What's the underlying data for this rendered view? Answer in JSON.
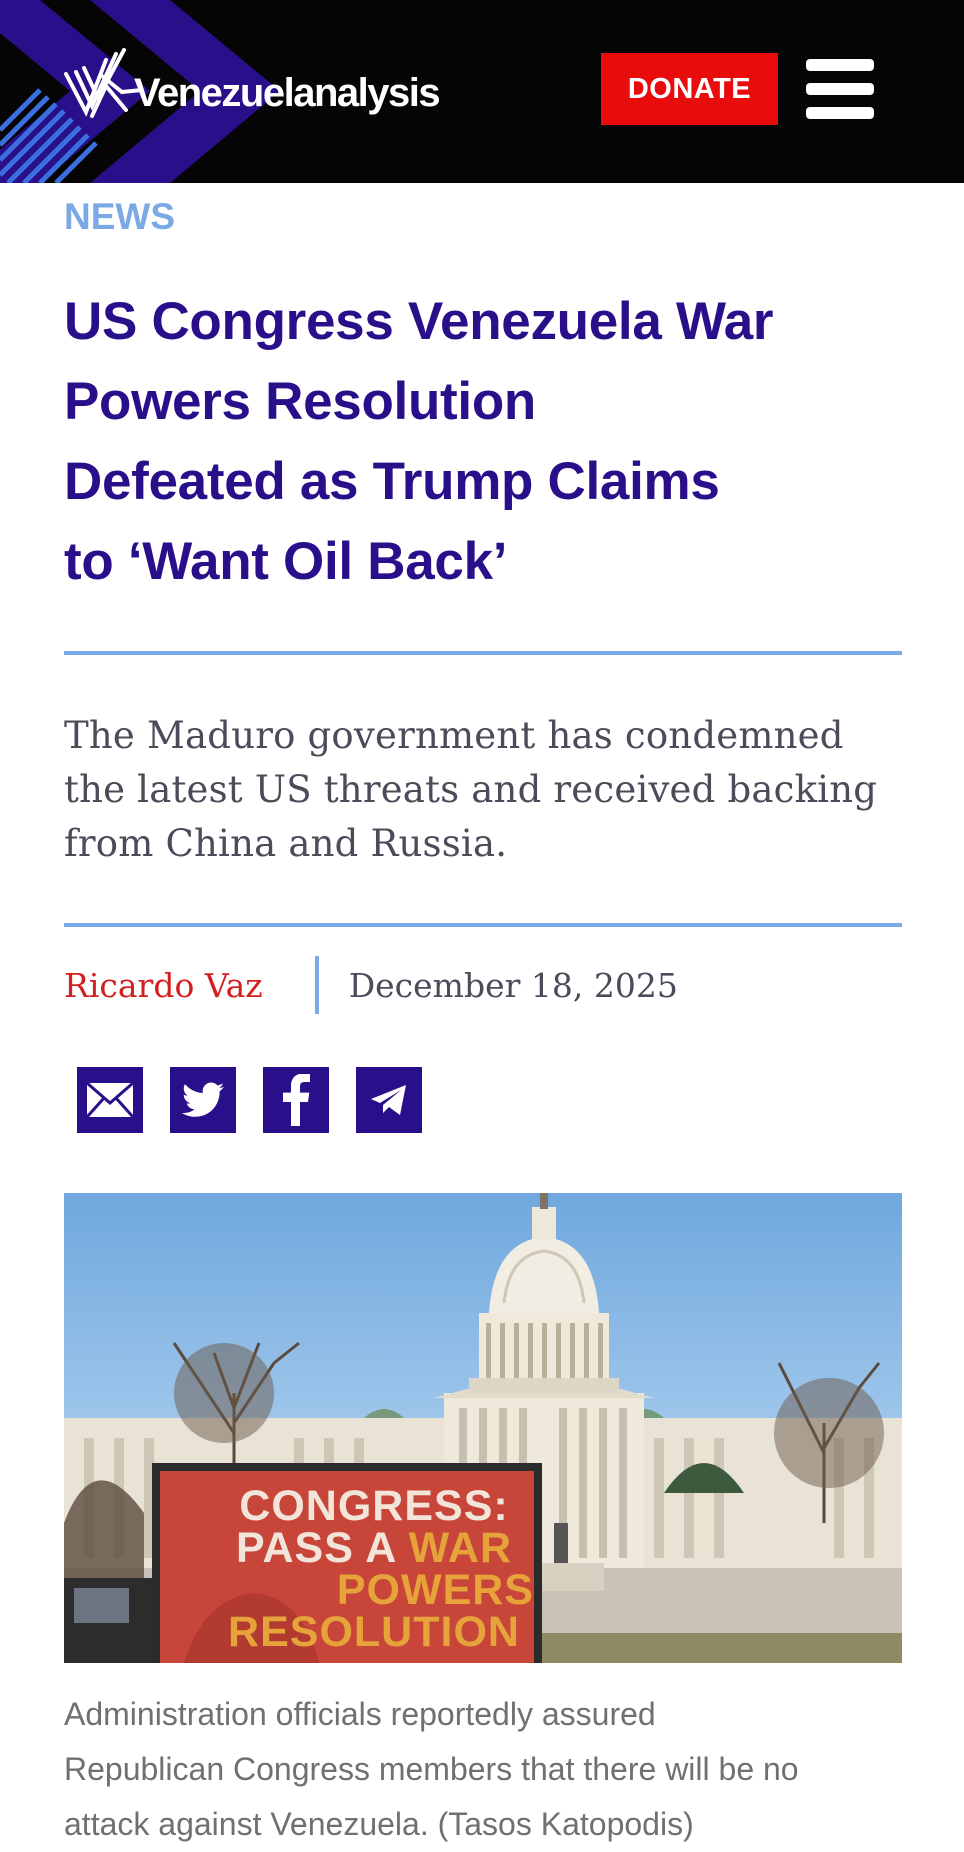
{
  "header": {
    "brand": "Venezuelanalysis",
    "donate_label": "DONATE",
    "colors": {
      "background": "#050505",
      "chevrons": "#2a0f8a",
      "donate": "#e90c0c"
    }
  },
  "article": {
    "category": "NEWS",
    "headline_lines": [
      "US Congress Venezuela War",
      "Powers Resolution",
      "Defeated as Trump Claims",
      "to ‘Want Oil Back’"
    ],
    "dek_lines": [
      "The Maduro government has condemned",
      "the latest US threats and received backing",
      "from China and Russia."
    ],
    "author": "Ricardo Vaz",
    "date": "December 18, 2025",
    "share_icons": [
      "email-icon",
      "twitter-icon",
      "facebook-icon",
      "telegram-icon"
    ],
    "colors": {
      "headline": "#2a0f8a",
      "accent": "#7aa9e6",
      "author": "#d31f1f"
    }
  },
  "photo": {
    "sign": {
      "line1": "CONGRESS:",
      "line2_a": "PASS A ",
      "line2_b": "WAR",
      "line3": "POWERS",
      "line4": "RESOLUTION"
    }
  },
  "caption_lines": [
    "Administration officials reportedly assured",
    "Republican Congress members that there will be no",
    "attack against Venezuela. (Tasos Katopodis)"
  ]
}
